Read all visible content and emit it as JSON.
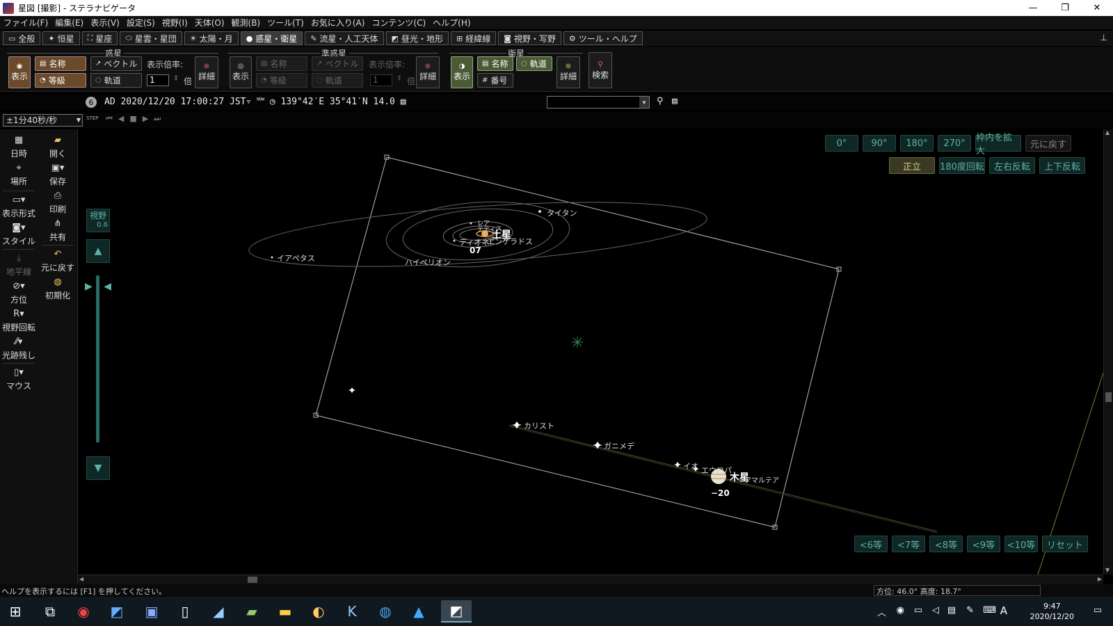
{
  "window": {
    "title": "星図 [撮影] - ステラナビゲータ",
    "min": "—",
    "max": "❐",
    "close": "✕"
  },
  "menu": [
    "ファイル(F)",
    "編集(E)",
    "表示(V)",
    "設定(S)",
    "視野(I)",
    "天体(O)",
    "観測(B)",
    "ツール(T)",
    "お気に入り(A)",
    "コンテンツ(C)",
    "ヘルプ(H)"
  ],
  "tabs": [
    {
      "label": "全般",
      "icon": "▭"
    },
    {
      "label": "恒星",
      "icon": "✦"
    },
    {
      "label": "星座",
      "icon": "⛶"
    },
    {
      "label": "星雲・星団",
      "icon": "⬭"
    },
    {
      "label": "太陽・月",
      "icon": "☀"
    },
    {
      "label": "惑星・衛星",
      "icon": "●"
    },
    {
      "label": "流星・人工天体",
      "icon": "✎"
    },
    {
      "label": "昼光・地形",
      "icon": "◩"
    },
    {
      "label": "経緯線",
      "icon": "⊞"
    },
    {
      "label": "視野・写野",
      "icon": "◙"
    },
    {
      "label": "ツール・ヘルプ",
      "icon": "⚙"
    }
  ],
  "ribbon": {
    "planets": {
      "title": "惑星",
      "show": "表示",
      "name": "名称",
      "mag": "等級",
      "vector": "ベクトル",
      "orbit": "軌道",
      "scale_label": "表示倍率:",
      "scale_value": "1",
      "scale_unit": "倍",
      "detail": "詳細"
    },
    "dwarfs": {
      "title": "準惑星",
      "show": "表示",
      "name": "名称",
      "mag": "等級",
      "vector": "ベクトル",
      "orbit": "軌道",
      "scale_label": "表示倍率:",
      "scale_value": "1",
      "scale_unit": "倍",
      "detail": "詳細"
    },
    "moons": {
      "title": "衛星",
      "show": "表示",
      "name": "名称",
      "orbit": "軌道",
      "number": "番号",
      "detail": "詳細"
    },
    "search": "検索"
  },
  "info": {
    "badge": "6",
    "datetime": "AD 2020/12/20 17:00:27 JST▿",
    "now": "NOW",
    "location": "139°42′E 35°41′N 14.0"
  },
  "speed": {
    "value": "±1分40秒/秒",
    "step": "STEP"
  },
  "lefttools": {
    "col1": [
      "日時",
      "場所",
      "表示形式",
      "スタイル",
      "地平線",
      "方位",
      "視野回転",
      "光跡残し",
      "マウス"
    ],
    "col2": [
      "開く",
      "保存",
      "印刷",
      "共有",
      "元に戻す",
      "初期化"
    ]
  },
  "sky": {
    "rotation_buttons": [
      "0°",
      "90°",
      "180°",
      "270°",
      "枠内を拡大",
      "元に戻す"
    ],
    "orient_buttons": [
      "正立",
      "180度回転",
      "左右反転",
      "上下反転"
    ],
    "mag_buttons": [
      "<6等",
      "<7等",
      "<8等",
      "<9等",
      "<10等",
      "リセット"
    ],
    "fov_label": "視野",
    "fov_value": "0.6",
    "saturn": {
      "name": "土星",
      "mag": "07"
    },
    "saturn_moons": [
      "タイタン",
      "イアペタス",
      "ハイペリオン",
      "レア",
      "テティス",
      "ディオネ",
      "エンケラドス"
    ],
    "jupiter": {
      "name": "木星",
      "mag": "−20"
    },
    "jupiter_moons": [
      "カリスト",
      "ガニメデ",
      "イオ",
      "エウロパ",
      "アマルテア"
    ]
  },
  "status": {
    "help": "ヘルプを表示するには [F1] を押してください。",
    "coord": "方位:  46.0° 高度:  18.7°"
  },
  "taskbar": {
    "time": "9:47",
    "date": "2020/12/20",
    "ime": "A"
  }
}
